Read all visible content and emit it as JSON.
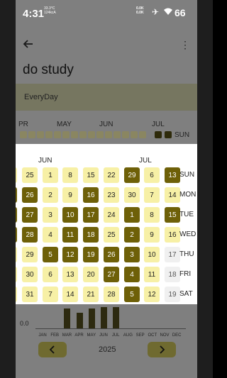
{
  "status": {
    "time": "4:31",
    "temp": "33.3°C",
    "temp_sub": "124kcA",
    "speed_up": "0.0K",
    "speed_down": "0.0K",
    "battery": "66"
  },
  "appbar": {
    "title": "do study"
  },
  "frequency": {
    "label": "EveryDay"
  },
  "behind_months": [
    "PR",
    "MAY",
    "JUN",
    "JUL"
  ],
  "behind_day": "SUN",
  "calendar": {
    "month_labels": [
      "JUN",
      "JUL"
    ],
    "weekdays": [
      "SUN",
      "MON",
      "TUE",
      "WED",
      "THU",
      "FRI",
      "SAT"
    ],
    "columns": [
      {
        "cells": [
          {
            "d": "",
            "s": 1
          },
          {
            "d": "",
            "s": 3
          },
          {
            "d": "",
            "s": 3
          },
          {
            "d": "",
            "s": 3
          },
          {
            "d": "",
            "s": 1
          },
          {
            "d": "",
            "s": 1
          },
          {
            "d": "",
            "s": 1
          }
        ]
      },
      {
        "cells": [
          {
            "d": "25",
            "s": 1
          },
          {
            "d": "26",
            "s": 3
          },
          {
            "d": "27",
            "s": 3
          },
          {
            "d": "28",
            "s": 3
          },
          {
            "d": "29",
            "s": 1
          },
          {
            "d": "30",
            "s": 1
          },
          {
            "d": "31",
            "s": 1
          }
        ]
      },
      {
        "cells": [
          {
            "d": "1",
            "s": 1
          },
          {
            "d": "2",
            "s": 1
          },
          {
            "d": "3",
            "s": 1
          },
          {
            "d": "4",
            "s": 1
          },
          {
            "d": "5",
            "s": 3
          },
          {
            "d": "6",
            "s": 1
          },
          {
            "d": "7",
            "s": 1
          }
        ]
      },
      {
        "cells": [
          {
            "d": "8",
            "s": 1
          },
          {
            "d": "9",
            "s": 1
          },
          {
            "d": "10",
            "s": 3
          },
          {
            "d": "11",
            "s": 3
          },
          {
            "d": "12",
            "s": 3
          },
          {
            "d": "13",
            "s": 1
          },
          {
            "d": "14",
            "s": 1
          }
        ]
      },
      {
        "cells": [
          {
            "d": "15",
            "s": 1
          },
          {
            "d": "16",
            "s": 3
          },
          {
            "d": "17",
            "s": 3
          },
          {
            "d": "18",
            "s": 3
          },
          {
            "d": "19",
            "s": 3
          },
          {
            "d": "20",
            "s": 1
          },
          {
            "d": "21",
            "s": 1
          }
        ]
      },
      {
        "cells": [
          {
            "d": "22",
            "s": 1
          },
          {
            "d": "23",
            "s": 1
          },
          {
            "d": "24",
            "s": 1
          },
          {
            "d": "25",
            "s": 1
          },
          {
            "d": "26",
            "s": 3
          },
          {
            "d": "27",
            "s": 3
          },
          {
            "d": "28",
            "s": 1
          }
        ]
      },
      {
        "cells": [
          {
            "d": "29",
            "s": 3
          },
          {
            "d": "30",
            "s": 1
          },
          {
            "d": "1",
            "s": 3
          },
          {
            "d": "2",
            "s": 3
          },
          {
            "d": "3",
            "s": 3
          },
          {
            "d": "4",
            "s": 3
          },
          {
            "d": "5",
            "s": 3
          }
        ]
      },
      {
        "cells": [
          {
            "d": "6",
            "s": 1
          },
          {
            "d": "7",
            "s": 1
          },
          {
            "d": "8",
            "s": 1
          },
          {
            "d": "9",
            "s": 1
          },
          {
            "d": "10",
            "s": 1
          },
          {
            "d": "11",
            "s": 1
          },
          {
            "d": "12",
            "s": 1
          }
        ]
      },
      {
        "cells": [
          {
            "d": "13",
            "s": 3
          },
          {
            "d": "14",
            "s": 1
          },
          {
            "d": "15",
            "s": 3
          },
          {
            "d": "16",
            "s": 1
          },
          {
            "d": "17",
            "s": 0
          },
          {
            "d": "18",
            "s": 0
          },
          {
            "d": "19",
            "s": 0
          }
        ]
      }
    ]
  },
  "chart": {
    "ylabel": "0.0",
    "months": [
      "JAN",
      "FEB",
      "MAR",
      "APR",
      "MAY",
      "JUN",
      "JUL",
      "AUG",
      "SEP",
      "OCT",
      "NOV",
      "DEC"
    ],
    "values": [
      0,
      0,
      0.28,
      0.22,
      0.28,
      0.3,
      0.3,
      0,
      0,
      0,
      0,
      0
    ]
  },
  "year": "2025",
  "icons": {
    "back": "arrow-left-icon",
    "more": "more-vert-icon",
    "prev": "chevron-left-icon",
    "next": "chevron-right-icon"
  }
}
